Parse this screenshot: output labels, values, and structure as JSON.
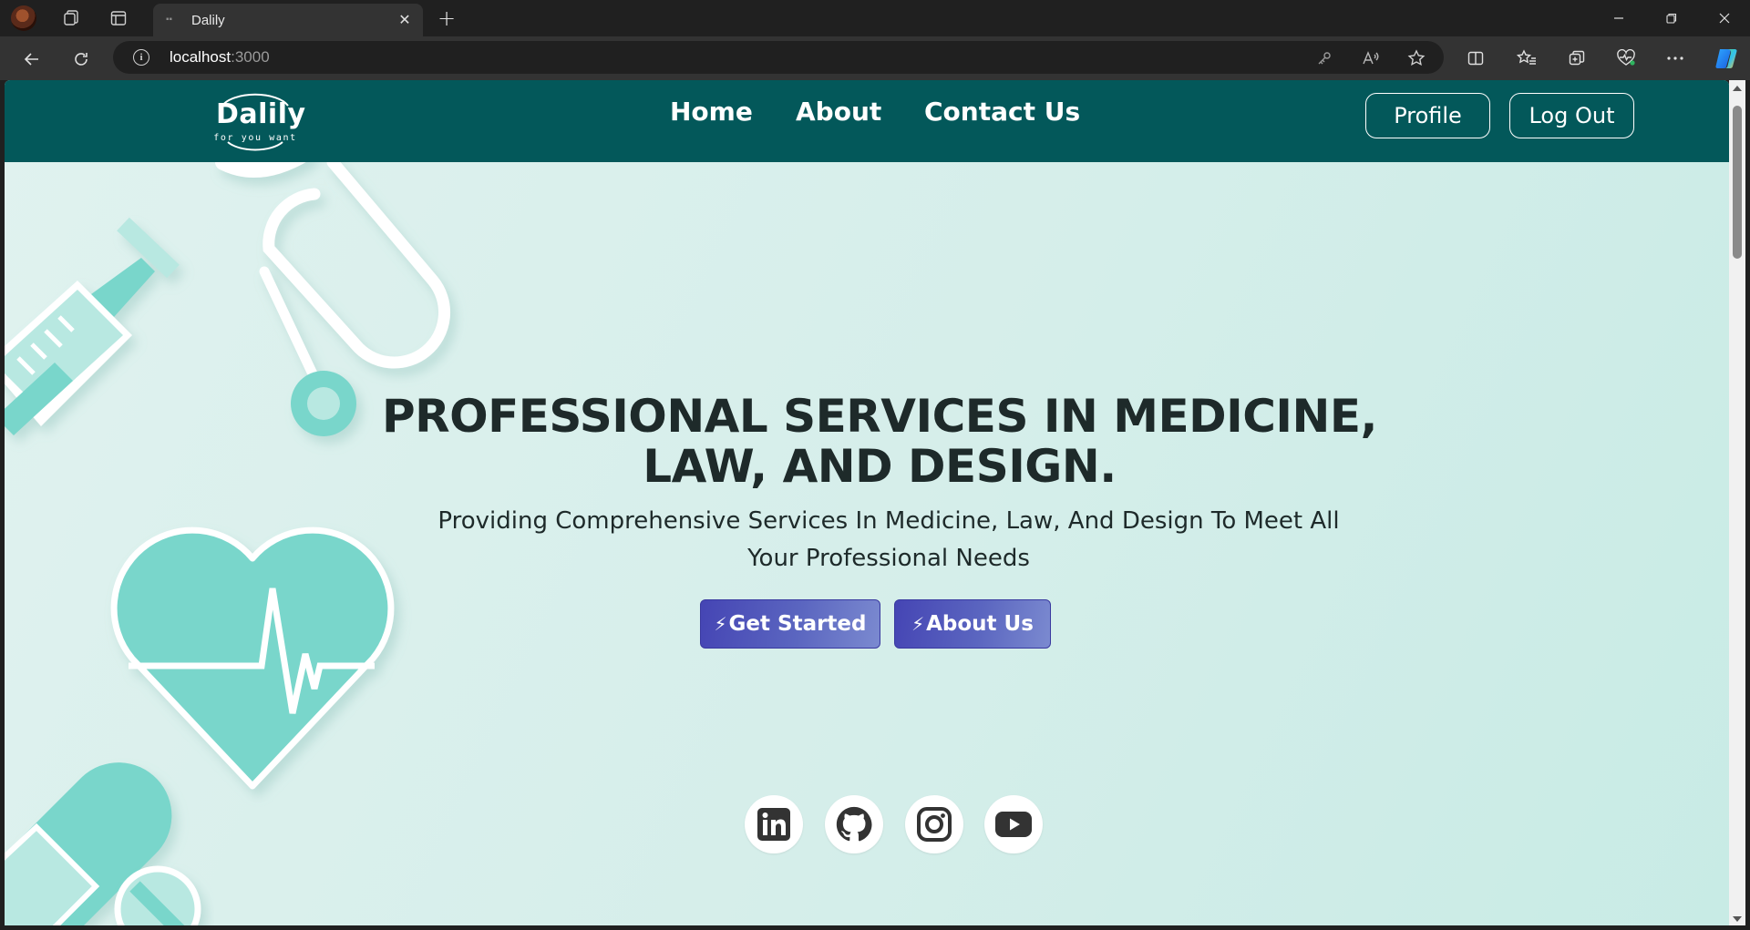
{
  "browser": {
    "tab_title": "Dalily",
    "url_host": "localhost",
    "url_port": ":3000"
  },
  "site": {
    "logo_text": "Dalily",
    "logo_tagline": "for you want",
    "nav": [
      "Home",
      "About",
      "Contact Us"
    ],
    "profile_label": "Profile",
    "logout_label": "Log Out"
  },
  "hero": {
    "title_line1": "PROFESSIONAL SERVICES IN MEDICINE,",
    "title_line2": "LAW, AND DESIGN.",
    "subtitle_line1": "Providing Comprehensive Services In Medicine, Law, And Design To Meet All",
    "subtitle_line2": "Your Professional Needs",
    "get_started_label": "Get Started",
    "about_us_label": "About Us"
  },
  "social": [
    "linkedin-icon",
    "github-icon",
    "instagram-icon",
    "youtube-icon"
  ],
  "colors": {
    "header": "#03585a",
    "accent_teal": "#79d6cb",
    "cta": "#4545b4",
    "text_dark": "#1e2a2a"
  }
}
